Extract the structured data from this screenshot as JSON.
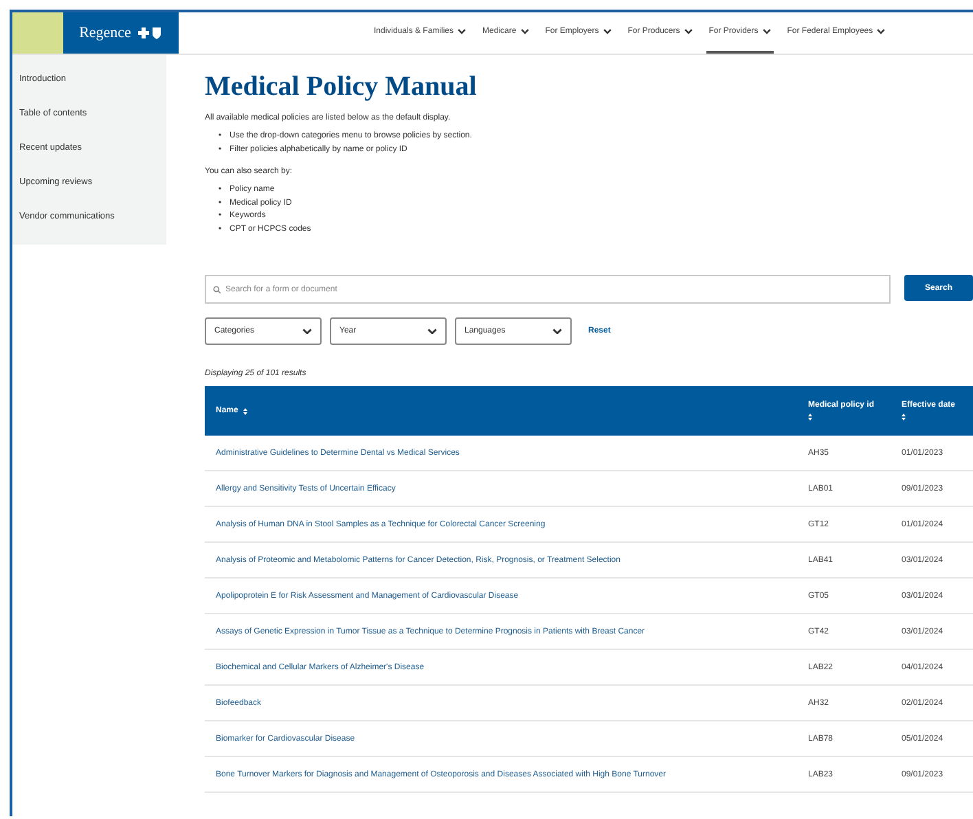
{
  "header": {
    "logo": "Regence",
    "nav": [
      {
        "label": "Individuals & Families",
        "selected": false
      },
      {
        "label": "Medicare",
        "selected": false
      },
      {
        "label": "For Employers",
        "selected": false
      },
      {
        "label": "For Producers",
        "selected": false
      },
      {
        "label": "For Providers",
        "selected": true
      },
      {
        "label": "For Federal Employees",
        "selected": false
      }
    ]
  },
  "sidebar": {
    "items": [
      "Introduction",
      "Table of contents",
      "Recent updates",
      "Upcoming reviews",
      "Vendor communications"
    ]
  },
  "title": "Medical Policy Manual",
  "intro": "All available medical policies are listed below as the default display.",
  "intro_bullets": [
    "Use the drop-down categories menu to browse policies by section.",
    "Filter policies alphabetically by name or policy ID"
  ],
  "bullet": "•",
  "search_by_label": "You can also search by:",
  "search_by_bullets": [
    "Policy name",
    "Medical policy ID",
    "Keywords",
    "CPT or HCPCS codes"
  ],
  "search": {
    "placeholder": "Search for a form or document",
    "button": "Search"
  },
  "filters": [
    "Categories",
    "Year",
    "Languages"
  ],
  "reset": "Reset",
  "result_count": "Displaying 25 of 101 results",
  "table": {
    "columns": [
      "Name",
      "Medical policy id",
      "Effective date"
    ],
    "rows": [
      [
        "Administrative Guidelines to Determine Dental vs Medical Services",
        "AH35",
        "01/01/2023"
      ],
      [
        "Allergy and Sensitivity Tests of Uncertain Efficacy",
        "LAB01",
        "09/01/2023"
      ],
      [
        "Analysis of Human DNA in Stool Samples as a Technique for Colorectal Cancer Screening",
        "GT12",
        "01/01/2024"
      ],
      [
        "Analysis of Proteomic and Metabolomic Patterns for Cancer Detection, Risk, Prognosis, or Treatment Selection",
        "LAB41",
        "03/01/2024"
      ],
      [
        "Apolipoprotein E for Risk Assessment and Management of Cardiovascular Disease",
        "GT05",
        "03/01/2024"
      ],
      [
        "Assays of Genetic Expression in Tumor Tissue as a Technique to Determine Prognosis in Patients with Breast Cancer",
        "GT42",
        "03/01/2024"
      ],
      [
        "Biochemical and Cellular Markers of Alzheimer's Disease",
        "LAB22",
        "04/01/2024"
      ],
      [
        "Biofeedback",
        "AH32",
        "02/01/2024"
      ],
      [
        "Biomarker for Cardiovascular Disease",
        "LAB78",
        "05/01/2024"
      ],
      [
        "Bone Turnover Markers for Diagnosis and Management of Osteoporosis and Diseases Associated with High Bone Turnover",
        "LAB23",
        "09/01/2023"
      ]
    ]
  }
}
